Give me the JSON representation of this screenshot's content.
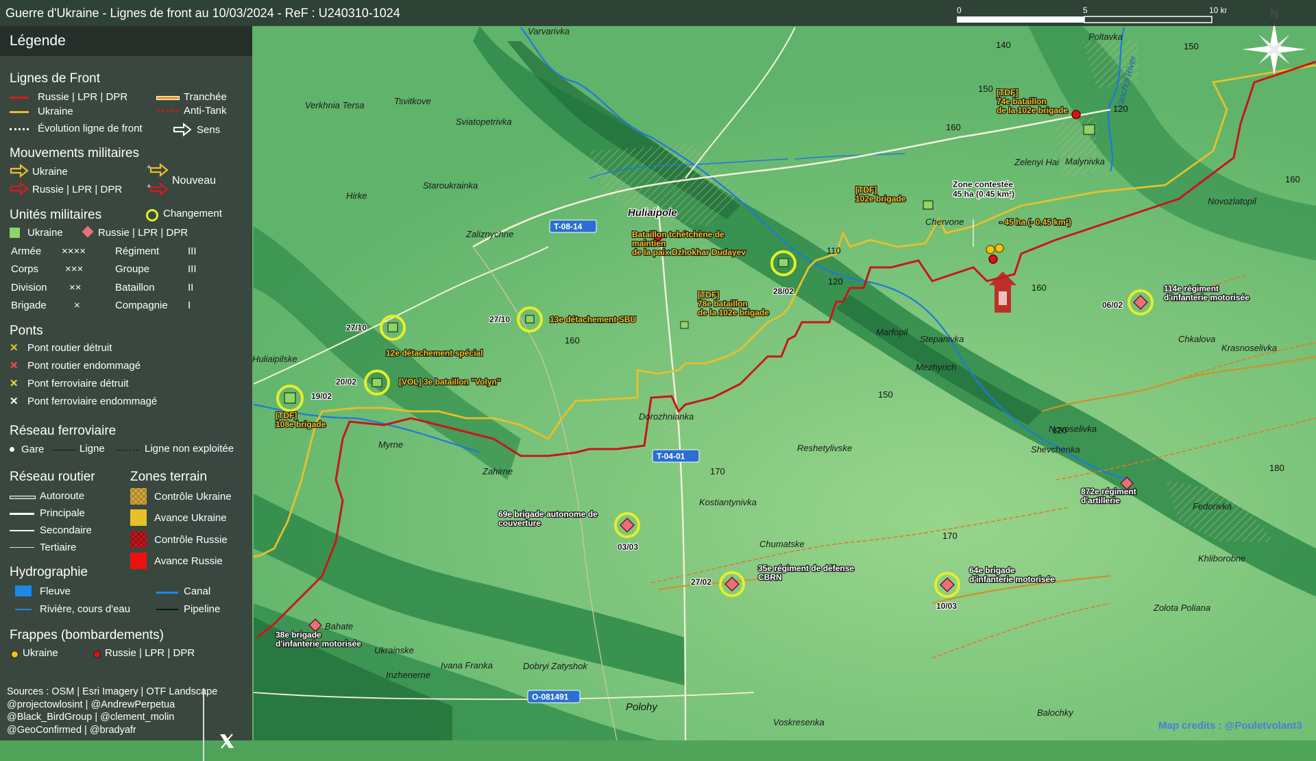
{
  "title": "Guerre d'Ukraine - Lignes de front au 10/03/2024 - ReF : U240310-1024",
  "scale": {
    "tick_0": "0",
    "tick_5": "5",
    "tick_10": "10 km"
  },
  "north": "N",
  "credits": "Map credits : @Pouletvolant3",
  "legend": {
    "heading": "Légende",
    "front_lines": {
      "heading": "Lignes de Front",
      "russia": "Russie | LPR | DPR",
      "ukraine": "Ukraine",
      "evolution": "Évolution ligne de front",
      "trench": "Tranchée",
      "antitank": "Anti-Tank",
      "direction": "Sens"
    },
    "movements": {
      "heading": "Mouvements militaires",
      "ukraine": "Ukraine",
      "russia": "Russie | LPR | DPR",
      "new": "Nouveau"
    },
    "units": {
      "heading": "Unités militaires",
      "change": "Changement",
      "ukraine": "Ukraine",
      "russia": "Russie | LPR | DPR",
      "rows": [
        {
          "name": "Armée",
          "sym": "××××",
          "name2": "Régiment",
          "sym2": "III"
        },
        {
          "name": "Corps",
          "sym": "×××",
          "name2": "Groupe",
          "sym2": "III"
        },
        {
          "name": "Division",
          "sym": "××",
          "name2": "Bataillon",
          "sym2": "II"
        },
        {
          "name": "Brigade",
          "sym": "×",
          "name2": "Compagnie",
          "sym2": "I"
        }
      ]
    },
    "bridges": {
      "heading": "Ponts",
      "road_destroyed": "Pont routier détruit",
      "road_damaged": "Pont routier endommagé",
      "rail_destroyed": "Pont ferroviaire détruit",
      "rail_damaged": "Pont ferroviaire endommagé"
    },
    "rail": {
      "heading": "Réseau ferroviaire",
      "station": "Gare",
      "line": "Ligne",
      "unused": "Ligne non exploitée"
    },
    "roads": {
      "heading": "Réseau routier",
      "motorway": "Autoroute",
      "main": "Principale",
      "secondary": "Secondaire",
      "tertiary": "Tertiaire"
    },
    "zones": {
      "heading": "Zones terrain",
      "ua_control": "Contrôle Ukraine",
      "ua_advance": "Avance Ukraine",
      "ru_control": "Contrôle Russie",
      "ru_advance": "Avance Russie"
    },
    "hydro": {
      "heading": "Hydrographie",
      "river": "Fleuve",
      "stream": "Rivière, cours d'eau",
      "canal": "Canal",
      "pipeline": "Pipeline"
    },
    "strikes": {
      "heading": "Frappes (bombardements)",
      "ukraine": "Ukraine",
      "russia": "Russie | LPR | DPR"
    },
    "sources": [
      "Sources : OSM | Esri Imagery | OTF Landscape",
      "@projectowlosint | @AndrewPerpetua",
      "@Black_BirdGroup | @clement_molin",
      "@GeoConfirmed | @bradyafr"
    ]
  },
  "colors": {
    "russia": "#c8161b",
    "ukraine": "#e8c02a",
    "ua_unit": "#8fd46a",
    "ru_unit": "#e8707a",
    "change_ring": "#e6ee2a",
    "river": "#2a7fe0",
    "road": "#f4f0dc"
  },
  "map_labels": {
    "places": [
      "Varvarivka",
      "Verkhnia Tersa",
      "Tsvitkove",
      "Sviatopetrivka",
      "Staroukrainka",
      "Hirke",
      "Zaliznychne",
      "Huliaipole",
      "Poltavka",
      "Malynivka",
      "Zelenyi Hai",
      "Chervone",
      "Novozlatopil",
      "Marfopil",
      "Stepanivka",
      "Mezhyrich",
      "Chkalova",
      "Krasnoselivka",
      "Huliaipilske",
      "Dorozhnianka",
      "Novoselivka",
      "Shevchenka",
      "Myrne",
      "Zahirne",
      "Reshetylivske",
      "Kostiantynivka",
      "Chumatske",
      "Fedorivka",
      "Khliborobne",
      "Zolota Poliana",
      "Bahate",
      "Ukrainske",
      "Inzhenerne",
      "Ivana Franka",
      "Dobryi Zatyshok",
      "Polohy",
      "Voskresenka",
      "Balochky",
      "Yanchul River"
    ],
    "roads": [
      "T-08-14",
      "T-04-01",
      "O-081491"
    ],
    "elevations": [
      "140",
      "150",
      "150",
      "120",
      "160",
      "160",
      "110",
      "120",
      "160",
      "160",
      "150",
      "120",
      "180",
      "170",
      "170"
    ],
    "contested_zone": [
      "Zone contestée",
      "45 ha (0.45 km²)"
    ],
    "loss": "- 45 ha (- 0.45 km²)"
  },
  "units": [
    {
      "id": "tdf-74",
      "side": "ukraine",
      "lines": [
        "[TDF]",
        "74e bataillon",
        "de la 102e brigade"
      ]
    },
    {
      "id": "tdf-102",
      "side": "ukraine",
      "lines": [
        "[TDF]",
        "102e brigade"
      ]
    },
    {
      "id": "chechen",
      "side": "ukraine",
      "lines": [
        "Bataillon tchétchène de",
        "maintien",
        "de la paix Dzhokhar Dudayev"
      ],
      "date": "28/02"
    },
    {
      "id": "tdf-78",
      "side": "ukraine",
      "lines": [
        "[TDF]",
        "78e bataillon",
        "de la 102e brigade"
      ]
    },
    {
      "id": "sbu-13",
      "side": "ukraine",
      "lines": [
        "13e détachement SBU"
      ],
      "date": "27/10"
    },
    {
      "id": "special-12",
      "side": "ukraine",
      "lines": [
        "12e détachement spécial"
      ],
      "date": "27/10"
    },
    {
      "id": "volyn",
      "side": "ukraine",
      "lines": [
        "[VOL] 3e bataillon \"Volyn\""
      ],
      "date": "20/02"
    },
    {
      "id": "tdf-108",
      "side": "ukraine",
      "lines": [
        "[TDF]",
        "108e brigade"
      ],
      "date": "19/02"
    },
    {
      "id": "ru-114",
      "side": "russia",
      "lines": [
        "114e régiment",
        "d'infanterie motorisée"
      ],
      "date": "06/02"
    },
    {
      "id": "ru-872",
      "side": "russia",
      "lines": [
        "872e régiment",
        "d'artillerie"
      ]
    },
    {
      "id": "ru-69",
      "side": "russia",
      "lines": [
        "69e brigade autonome de",
        "couverture"
      ],
      "date": "03/03"
    },
    {
      "id": "ru-35",
      "side": "russia",
      "lines": [
        "35e régiment de défense",
        "CBRN"
      ],
      "date": "27/02"
    },
    {
      "id": "ru-64",
      "side": "russia",
      "lines": [
        "64e brigade",
        "d'infanterie motorisée"
      ],
      "date": "10/03"
    },
    {
      "id": "ru-38",
      "side": "russia",
      "lines": [
        "38e brigade",
        "d'infanterie motorisée"
      ]
    }
  ]
}
